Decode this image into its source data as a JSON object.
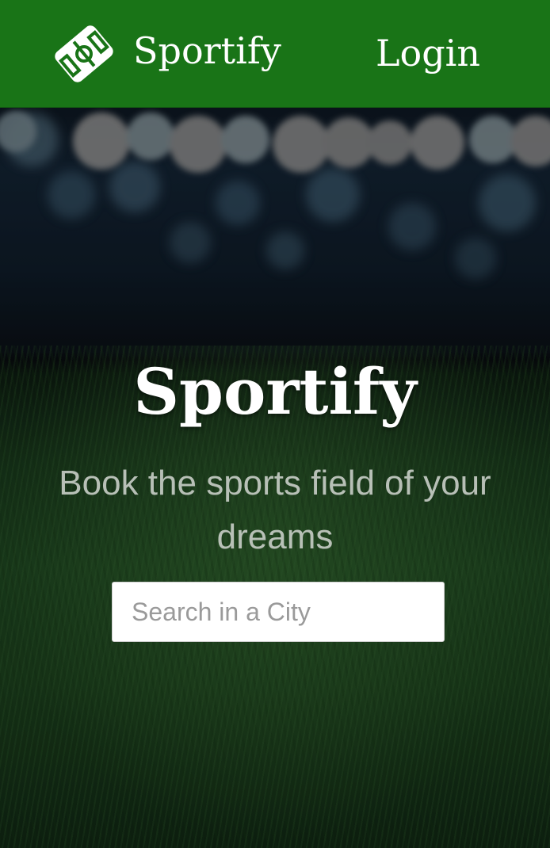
{
  "header": {
    "logo_icon": "soccer-field-icon",
    "brand_name": "Sportify",
    "login_label": "Login",
    "background_color": "#197417"
  },
  "hero": {
    "title": "Sportify",
    "subtitle": "Book the sports field of your dreams",
    "search": {
      "placeholder": "Search in a City",
      "value": ""
    }
  }
}
